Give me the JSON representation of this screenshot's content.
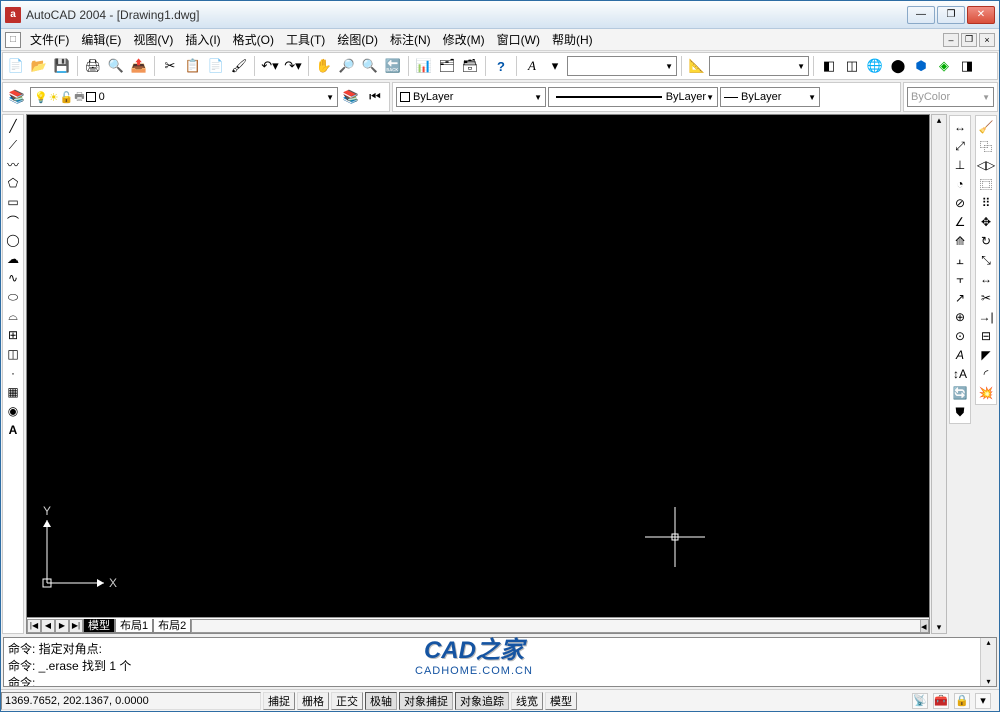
{
  "title": "AutoCAD 2004 - [Drawing1.dwg]",
  "app_icon_letter": "a",
  "mdi_icon_letter": "□",
  "menus": [
    "文件(F)",
    "编辑(E)",
    "视图(V)",
    "插入(I)",
    "格式(O)",
    "工具(T)",
    "绘图(D)",
    "标注(N)",
    "修改(M)",
    "窗口(W)",
    "帮助(H)"
  ],
  "layer_current": "0",
  "linetype_current": "ByLayer",
  "lineweight_current": "ByLayer",
  "plotstyle_current": "ByLayer",
  "color_current": "ByColor",
  "tabs": {
    "nav": [
      "|◀",
      "◀",
      "▶",
      "▶|"
    ],
    "items": [
      "模型",
      "布局1",
      "布局2"
    ],
    "active": 0
  },
  "command_lines": [
    "命令:  指定对角点:",
    "命令: _.erase 找到 1 个",
    "命令:"
  ],
  "status": {
    "coords": "1369.7652, 202.1367, 0.0000",
    "toggles": [
      "捕捉",
      "栅格",
      "正交",
      "极轴",
      "对象捕捉",
      "对象追踪",
      "线宽",
      "模型"
    ],
    "active_toggles": [
      3,
      4,
      5
    ]
  },
  "watermark": {
    "big": "CAD之家",
    "small": "CADHOME.COM.CN"
  },
  "ucs": {
    "x": "X",
    "y": "Y"
  }
}
